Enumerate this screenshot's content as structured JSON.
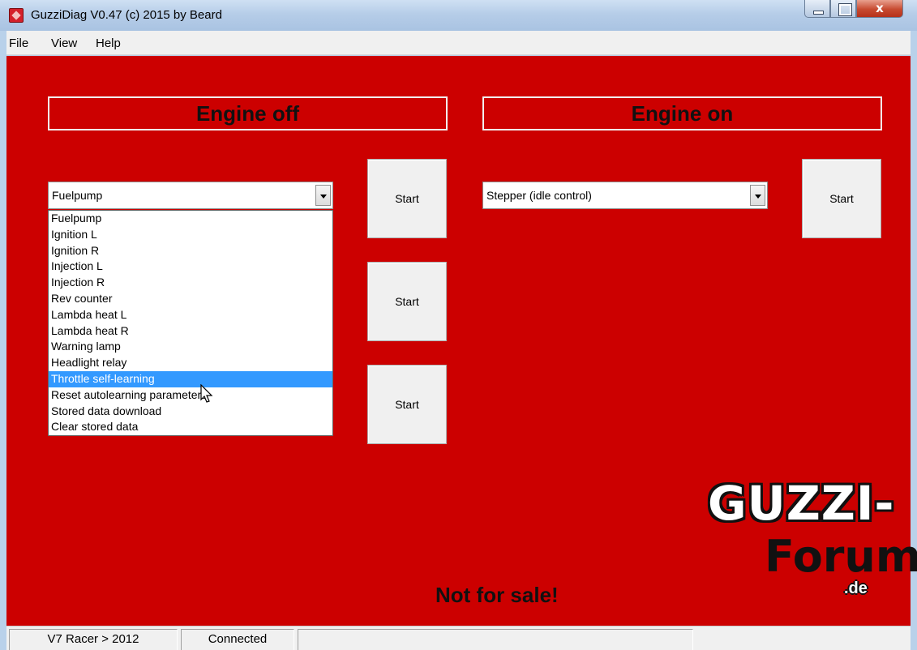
{
  "window": {
    "title": "GuzziDiag V0.47  (c) 2015 by Beard",
    "close_label": "x"
  },
  "menu": {
    "file": "File",
    "view": "View",
    "help": "Help"
  },
  "engine_off": {
    "title": "Engine off",
    "combo_value": "Fuelpump",
    "options": [
      "Fuelpump",
      "Ignition L",
      "Ignition R",
      "Injection L",
      "Injection R",
      "Rev counter",
      "Lambda heat L",
      "Lambda heat R",
      "Warning lamp",
      "Headlight relay",
      "Throttle self-learning",
      "Reset autolearning parameters",
      "Stored data download",
      "Clear stored data"
    ],
    "highlighted_option": "Throttle self-learning",
    "start_labels": [
      "Start",
      "Start",
      "Start"
    ]
  },
  "engine_on": {
    "title": "Engine on",
    "combo_value": "Stepper (idle control)",
    "start_label": "Start"
  },
  "footer_notice": "Not for sale!",
  "logo": {
    "line1": "GUZZI-",
    "line2": "Forum",
    "line3": ".de"
  },
  "status": {
    "model": "V7 Racer > 2012",
    "connection": "Connected",
    "extra": ""
  },
  "colors": {
    "client_background": "#cc0000",
    "selection": "#3399ff"
  }
}
